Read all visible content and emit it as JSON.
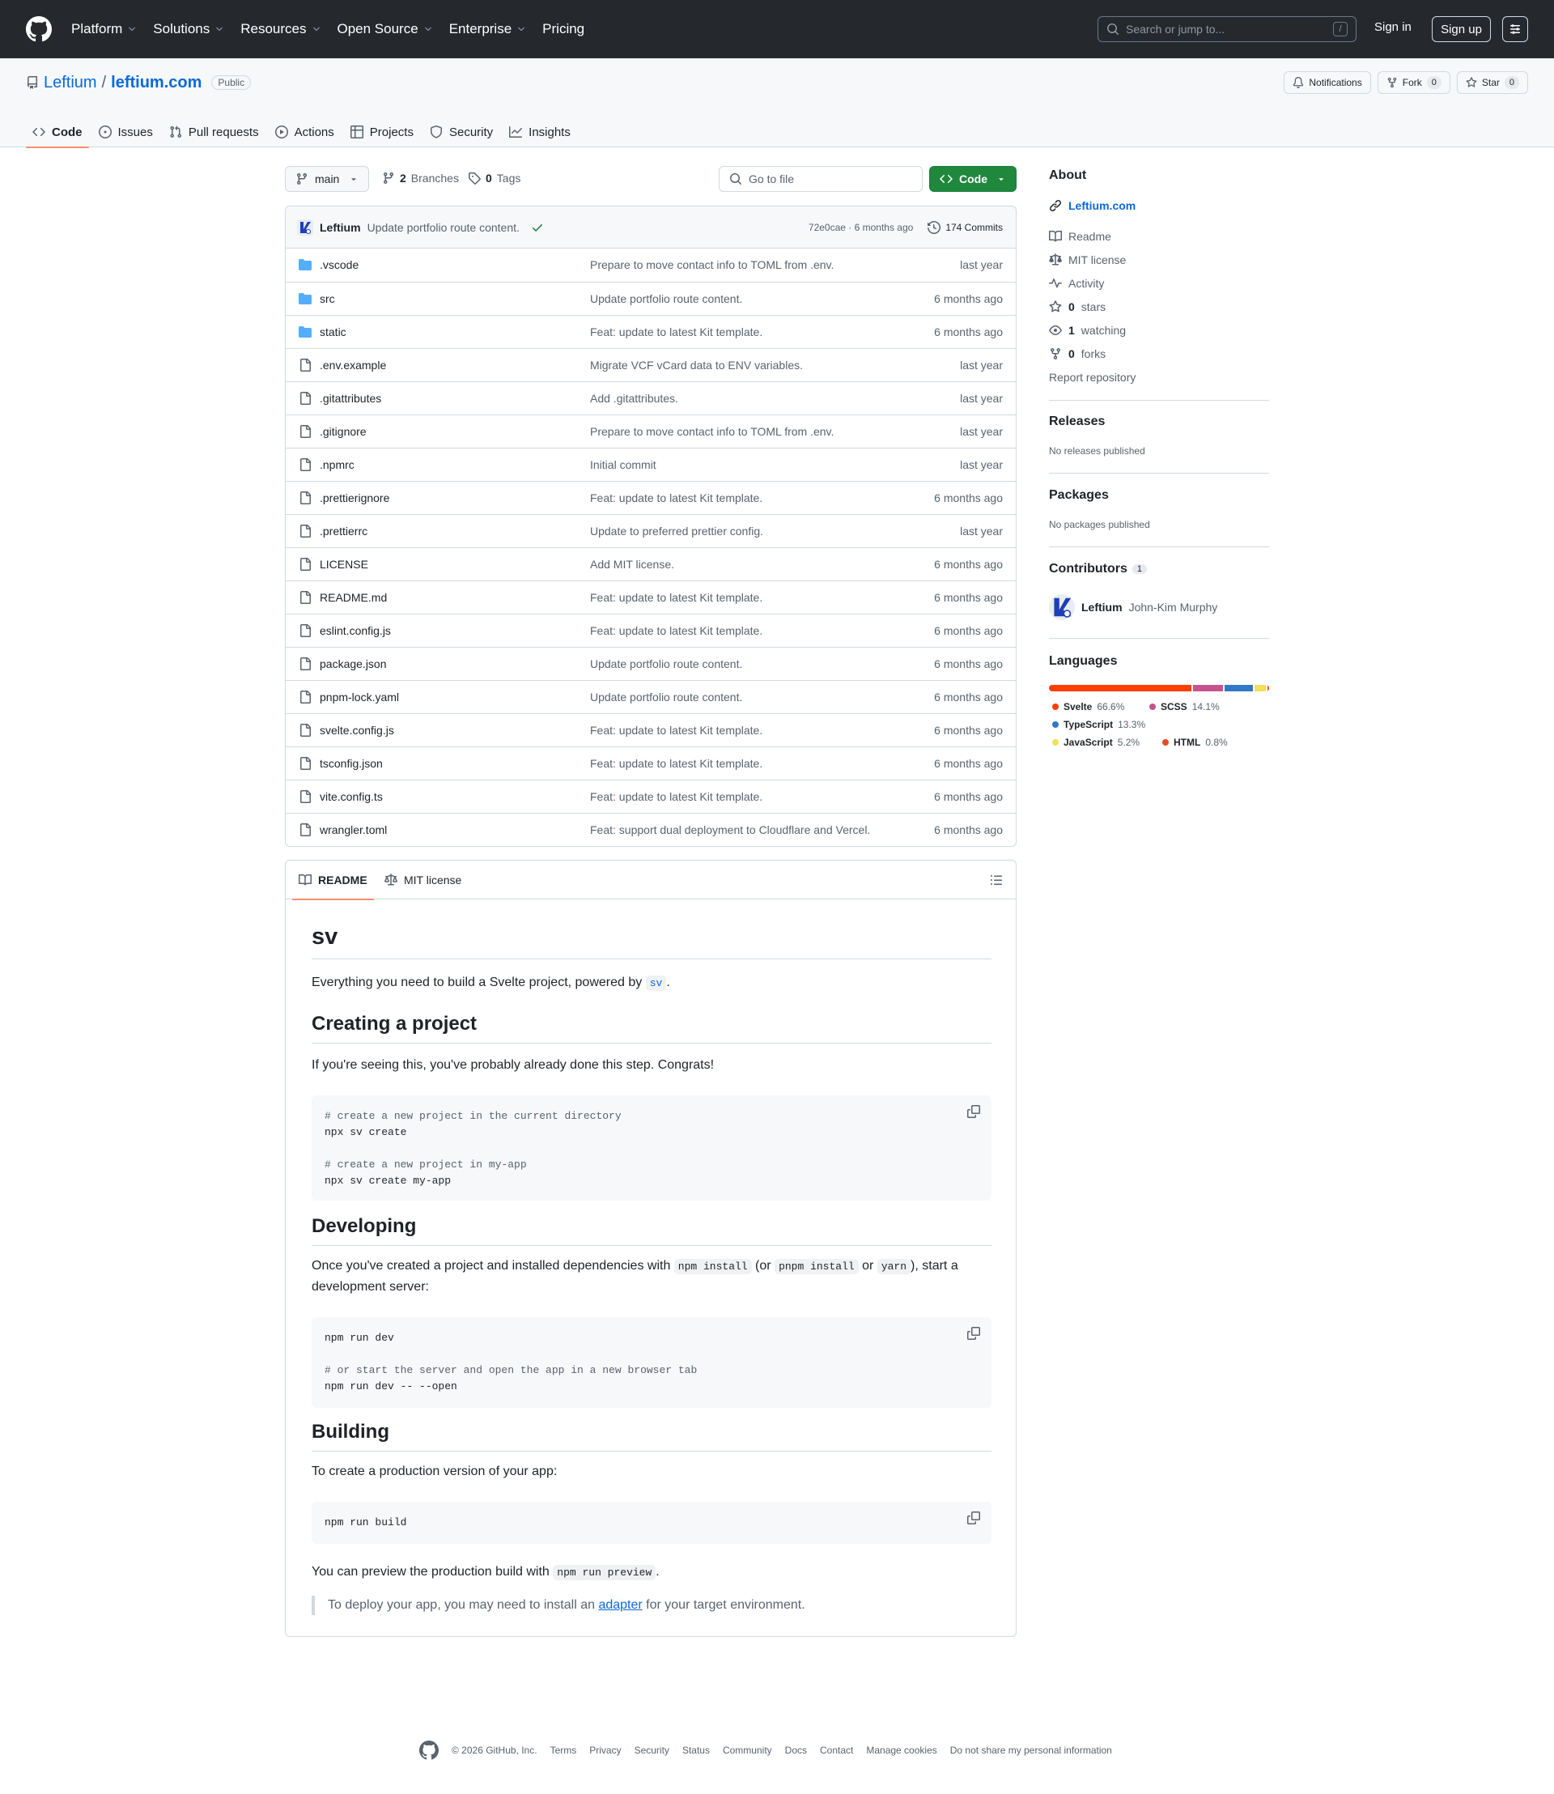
{
  "header": {
    "nav": [
      "Platform",
      "Solutions",
      "Resources",
      "Open Source",
      "Enterprise",
      "Pricing"
    ],
    "search_placeholder": "Search or jump to...",
    "search_shortcut": "/",
    "signin": "Sign in",
    "signup": "Sign up"
  },
  "repo": {
    "owner": "Leftium",
    "separator": "/",
    "name": "leftium.com",
    "visibility": "Public",
    "notifications": "Notifications",
    "fork_label": "Fork",
    "fork_count": "0",
    "star_label": "Star",
    "star_count": "0",
    "tabs": [
      "Code",
      "Issues",
      "Pull requests",
      "Actions",
      "Projects",
      "Security",
      "Insights"
    ]
  },
  "branchbar": {
    "branch": "main",
    "branches_count": "2",
    "branches_label": "Branches",
    "tags_count": "0",
    "tags_label": "Tags",
    "goto_placeholder": "Go to file",
    "code_label": "Code"
  },
  "commit": {
    "author": "Leftium",
    "message": "Update portfolio route content.",
    "meta": "72e0cae · 6 months ago",
    "commits": "174 Commits"
  },
  "files": [
    {
      "type": "dir",
      "name": ".vscode",
      "message": "Prepare to move contact info to TOML from .env.",
      "date": "last year"
    },
    {
      "type": "dir",
      "name": "src",
      "message": "Update portfolio route content.",
      "date": "6 months ago"
    },
    {
      "type": "dir",
      "name": "static",
      "message": "Feat: update to latest Kit template.",
      "date": "6 months ago"
    },
    {
      "type": "file",
      "name": ".env.example",
      "message": "Migrate VCF vCard data to ENV variables.",
      "date": "last year"
    },
    {
      "type": "file",
      "name": ".gitattributes",
      "message": "Add .gitattributes.",
      "date": "last year"
    },
    {
      "type": "file",
      "name": ".gitignore",
      "message": "Prepare to move contact info to TOML from .env.",
      "date": "last year"
    },
    {
      "type": "file",
      "name": ".npmrc",
      "message": "Initial commit",
      "date": "last year"
    },
    {
      "type": "file",
      "name": ".prettierignore",
      "message": "Feat: update to latest Kit template.",
      "date": "6 months ago"
    },
    {
      "type": "file",
      "name": ".prettierrc",
      "message": "Update to preferred prettier config.",
      "date": "last year"
    },
    {
      "type": "file",
      "name": "LICENSE",
      "message": "Add MIT license.",
      "date": "6 months ago"
    },
    {
      "type": "file",
      "name": "README.md",
      "message": "Feat: update to latest Kit template.",
      "date": "6 months ago"
    },
    {
      "type": "file",
      "name": "eslint.config.js",
      "message": "Feat: update to latest Kit template.",
      "date": "6 months ago"
    },
    {
      "type": "file",
      "name": "package.json",
      "message": "Update portfolio route content.",
      "date": "6 months ago"
    },
    {
      "type": "file",
      "name": "pnpm-lock.yaml",
      "message": "Update portfolio route content.",
      "date": "6 months ago"
    },
    {
      "type": "file",
      "name": "svelte.config.js",
      "message": "Feat: update to latest Kit template.",
      "date": "6 months ago"
    },
    {
      "type": "file",
      "name": "tsconfig.json",
      "message": "Feat: update to latest Kit template.",
      "date": "6 months ago"
    },
    {
      "type": "file",
      "name": "vite.config.ts",
      "message": "Feat: update to latest Kit template.",
      "date": "6 months ago"
    },
    {
      "type": "file",
      "name": "wrangler.toml",
      "message": "Feat: support dual deployment to Cloudflare and Vercel.",
      "date": "6 months ago"
    }
  ],
  "readme": {
    "tab_readme": "README",
    "tab_license": "MIT license",
    "h1": "sv",
    "intro_before": "Everything you need to build a Svelte project, powered by ",
    "intro_code": "sv",
    "intro_after": ".",
    "h2_create": "Creating a project",
    "p_create": "If you're seeing this, you've probably already done this step. Congrats!",
    "code_create": {
      "c1": "# create a new project in the current directory",
      "l1": "npx sv create",
      "c2": "# create a new project in my-app",
      "l2": "npx sv create my-app"
    },
    "h2_dev": "Developing",
    "p_dev_1": "Once you've created a project and installed dependencies with ",
    "p_dev_code1": "npm install",
    "p_dev_2": " (or ",
    "p_dev_code2": "pnpm install",
    "p_dev_3": " or ",
    "p_dev_code3": "yarn",
    "p_dev_4": "), start a development server:",
    "code_dev": {
      "l1": "npm run dev",
      "c1": "# or start the server and open the app in a new browser tab",
      "l2": "npm run dev -- --open"
    },
    "h2_build": "Building",
    "p_build": "To create a production version of your app:",
    "code_build": "npm run build",
    "p_preview_1": "You can preview the production build with ",
    "p_preview_code": "npm run preview",
    "p_preview_2": ".",
    "quote_1": "To deploy your app, you may need to install an ",
    "quote_link": "adapter",
    "quote_2": " for your target environment."
  },
  "sidebar": {
    "about": "About",
    "website": "Leftium.com",
    "readme": "Readme",
    "license": "MIT license",
    "activity": "Activity",
    "stars_count": "0",
    "stars_label": "stars",
    "watching_count": "1",
    "watching_label": "watching",
    "forks_count": "0",
    "forks_label": "forks",
    "report": "Report repository",
    "releases": "Releases",
    "no_releases": "No releases published",
    "packages": "Packages",
    "no_packages": "No packages published",
    "contributors": "Contributors",
    "contributors_count": "1",
    "contributor_login": "Leftium",
    "contributor_name": "John-Kim Murphy",
    "languages_title": "Languages",
    "languages": [
      {
        "name": "Svelte",
        "pct": "66.6%",
        "value": 66.6,
        "color": "#ff3e00"
      },
      {
        "name": "SCSS",
        "pct": "14.1%",
        "value": 14.1,
        "color": "#c6538c"
      },
      {
        "name": "TypeScript",
        "pct": "13.3%",
        "value": 13.3,
        "color": "#3178c6"
      },
      {
        "name": "JavaScript",
        "pct": "5.2%",
        "value": 5.2,
        "color": "#f1e05a"
      },
      {
        "name": "HTML",
        "pct": "0.8%",
        "value": 0.8,
        "color": "#e34c26"
      }
    ]
  },
  "footer": {
    "copyright": "© 2026 GitHub, Inc.",
    "links": [
      "Terms",
      "Privacy",
      "Security",
      "Status",
      "Community",
      "Docs",
      "Contact",
      "Manage cookies",
      "Do not share my personal information"
    ]
  }
}
